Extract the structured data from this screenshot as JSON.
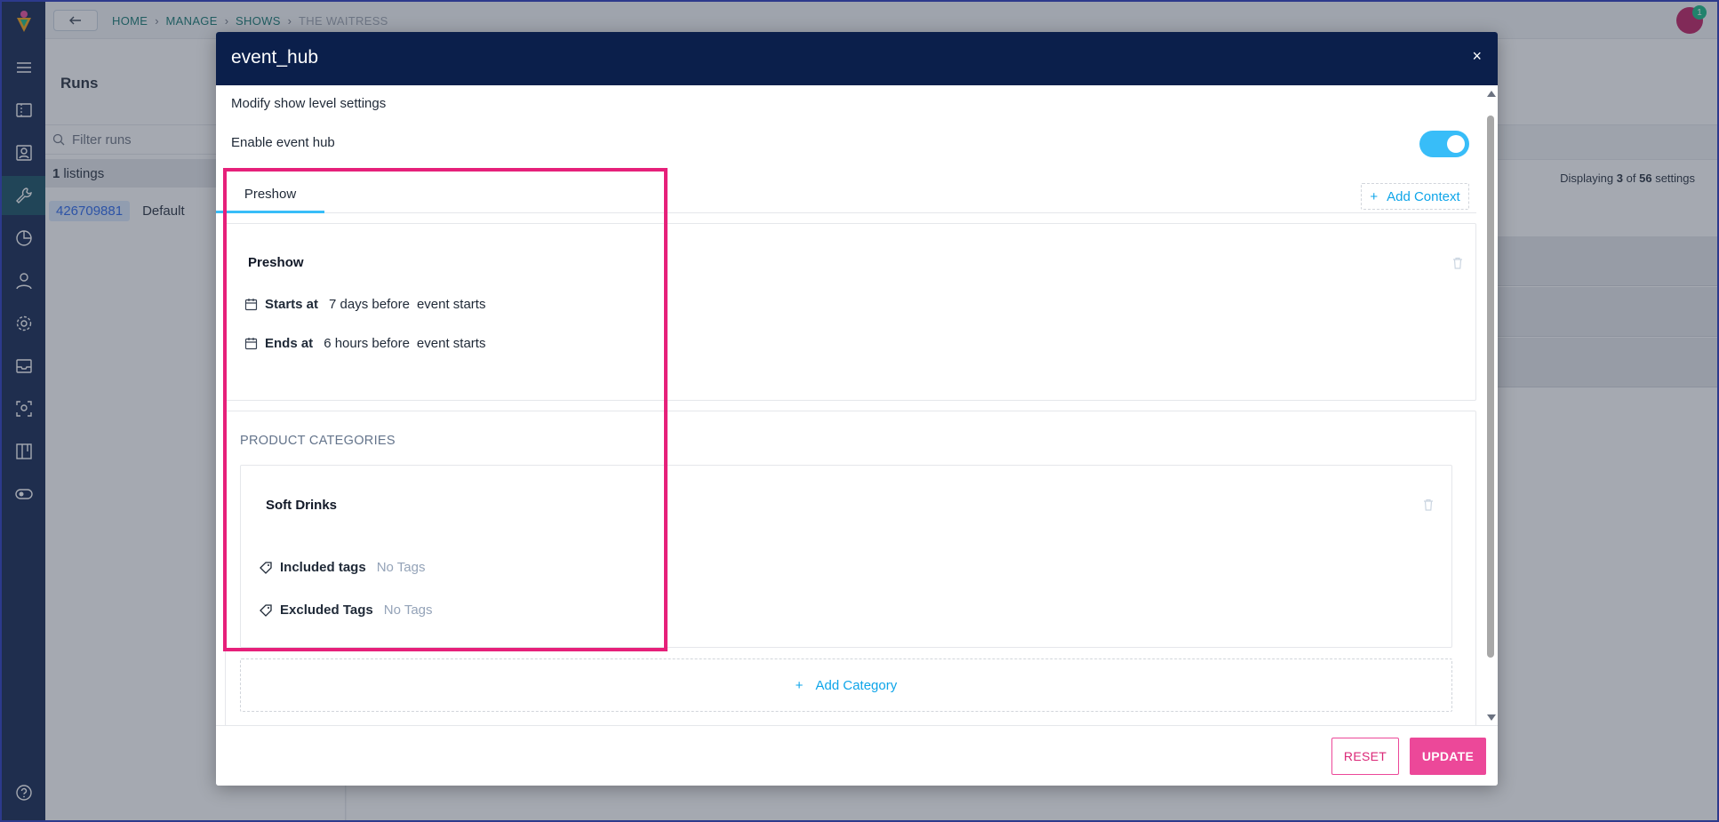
{
  "breadcrumbs": [
    "HOME",
    "MANAGE",
    "SHOWS",
    "THE WAITRESS"
  ],
  "notifications": {
    "count": "1"
  },
  "runs": {
    "title": "Runs",
    "filter_placeholder": "Filter runs",
    "listings_count": "1",
    "listings_label": "listings",
    "rows": [
      {
        "id": "426709881",
        "name": "Default"
      }
    ]
  },
  "settings_summary": {
    "prefix": "Displaying",
    "shown": "3",
    "of": "of",
    "total": "56",
    "suffix": "settings"
  },
  "modal": {
    "title": "event_hub",
    "close_label": "×",
    "subtitle": "Modify show level settings",
    "enable_label": "Enable event hub",
    "enable_value": true,
    "tabs": [
      {
        "label": "Preshow",
        "active": true
      }
    ],
    "add_context_label": "Add Context",
    "context": {
      "name": "Preshow",
      "starts_label": "Starts at",
      "starts_offset": "7 days before",
      "starts_ref": "event starts",
      "ends_label": "Ends at",
      "ends_offset": "6 hours before",
      "ends_ref": "event starts"
    },
    "categories": {
      "heading": "PRODUCT CATEGORIES",
      "items": [
        {
          "name": "Soft Drinks",
          "included_label": "Included tags",
          "included_value": "No Tags",
          "excluded_label": "Excluded Tags",
          "excluded_value": "No Tags"
        }
      ],
      "add_label": "Add Category"
    },
    "reset_label": "RESET",
    "update_label": "UPDATE"
  },
  "colors": {
    "navy": "#0b1f4b",
    "accent_pink": "#ec4899",
    "highlight": "#e6207a",
    "link_blue": "#0ea5e9",
    "toggle_on": "#38bdf8"
  }
}
